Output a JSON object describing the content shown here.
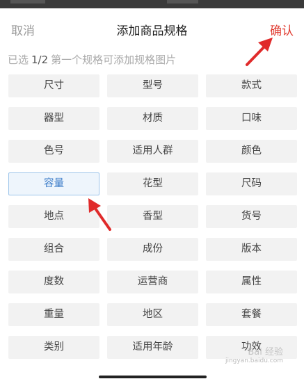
{
  "header": {
    "cancel_label": "取消",
    "title": "添加商品规格",
    "confirm_label": "确认"
  },
  "subtitle": {
    "prefix": "已选",
    "count": "1/2",
    "hint": "第一个规格可添加规格图片"
  },
  "specs": [
    {
      "label": "尺寸",
      "selected": false
    },
    {
      "label": "型号",
      "selected": false
    },
    {
      "label": "款式",
      "selected": false
    },
    {
      "label": "器型",
      "selected": false
    },
    {
      "label": "材质",
      "selected": false
    },
    {
      "label": "口味",
      "selected": false
    },
    {
      "label": "色号",
      "selected": false
    },
    {
      "label": "适用人群",
      "selected": false
    },
    {
      "label": "颜色",
      "selected": false
    },
    {
      "label": "容量",
      "selected": true
    },
    {
      "label": "花型",
      "selected": false
    },
    {
      "label": "尺码",
      "selected": false
    },
    {
      "label": "地点",
      "selected": false
    },
    {
      "label": "香型",
      "selected": false
    },
    {
      "label": "货号",
      "selected": false
    },
    {
      "label": "组合",
      "selected": false
    },
    {
      "label": "成份",
      "selected": false
    },
    {
      "label": "版本",
      "selected": false
    },
    {
      "label": "度数",
      "selected": false
    },
    {
      "label": "运营商",
      "selected": false
    },
    {
      "label": "属性",
      "selected": false
    },
    {
      "label": "重量",
      "selected": false
    },
    {
      "label": "地区",
      "selected": false
    },
    {
      "label": "套餐",
      "selected": false
    },
    {
      "label": "类别",
      "selected": false
    },
    {
      "label": "适用年龄",
      "selected": false
    },
    {
      "label": "功效",
      "selected": false
    }
  ],
  "watermark": {
    "text": "Bai 经验",
    "sub": "jingyan.baidu.com"
  },
  "colors": {
    "accent_red": "#e03a2f",
    "selected_blue": "#3a7bc8",
    "arrow": "#e02b2b"
  }
}
